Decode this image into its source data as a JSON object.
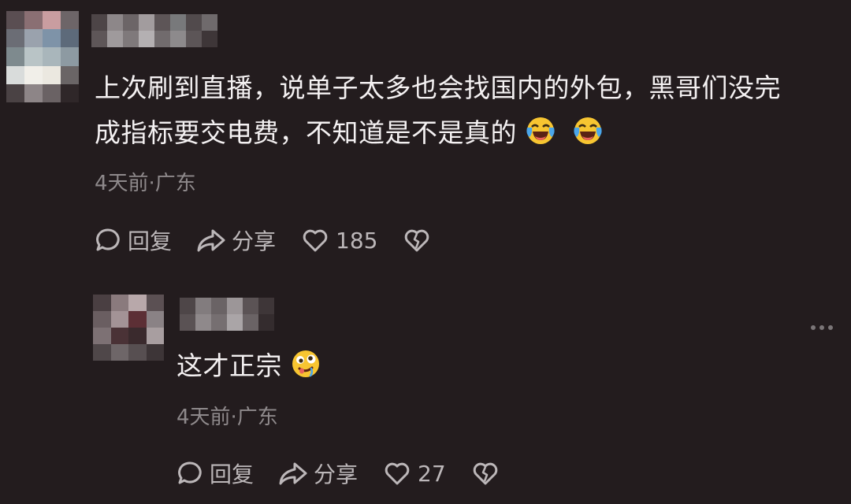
{
  "comments": [
    {
      "text": "上次刷到直播，说单子太多也会找国内的外包，黑哥们没完",
      "text_line2": "成指标要交电费，不知道是不是真的",
      "emojis": [
        "laughing-crying-emoji",
        "laughing-crying-emoji"
      ],
      "meta": "4天前·广东",
      "reply_label": "回复",
      "share_label": "分享",
      "like_count": "185"
    },
    {
      "text": "这才正宗",
      "emojis": [
        "drooling-emoji"
      ],
      "meta": "4天前·广东",
      "reply_label": "回复",
      "share_label": "分享",
      "like_count": "27"
    }
  ],
  "icons": {
    "reply": "reply-bubble-icon",
    "share": "share-arrow-icon",
    "like": "heart-icon",
    "dislike": "broken-heart-icon",
    "more": "more-dots-icon"
  },
  "colors": {
    "background": "#231c1e",
    "text": "#f4f1f2",
    "meta": "#8e898b",
    "action": "#bcb7b9"
  }
}
